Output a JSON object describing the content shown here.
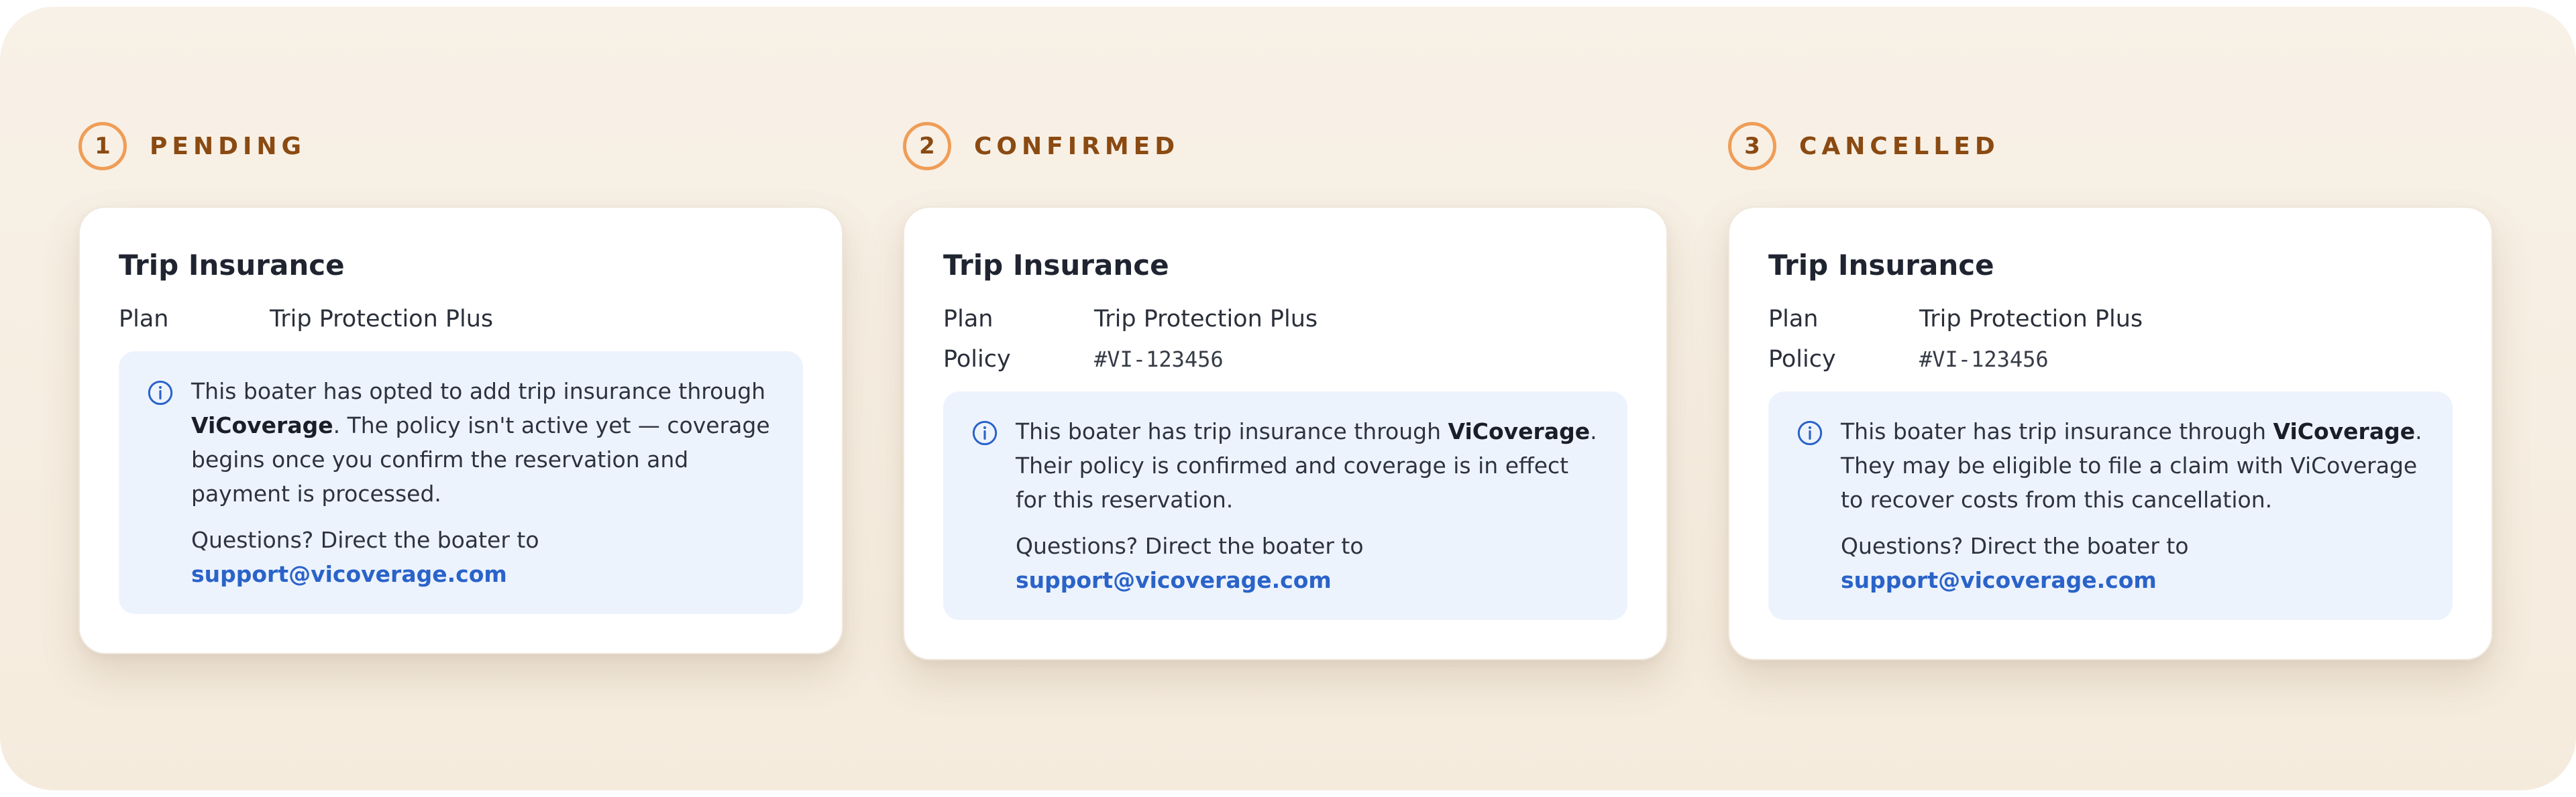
{
  "steps": [
    {
      "number": "1",
      "status": "PENDING",
      "card": {
        "title": "Trip Insurance",
        "plan_label": "Plan",
        "plan_value": "Trip Protection Plus",
        "message_before": "This boater has opted to add trip insurance through ",
        "provider": "ViCoverage",
        "message_after": ". The policy isn't active yet — coverage begins once you confirm the reservation and payment is processed.",
        "questions_text": "Questions? Direct the boater to",
        "support_email": "support@vicoverage.com"
      }
    },
    {
      "number": "2",
      "status": "CONFIRMED",
      "card": {
        "title": "Trip Insurance",
        "plan_label": "Plan",
        "plan_value": "Trip Protection Plus",
        "policy_label": "Policy",
        "policy_value": "#VI-123456",
        "message_before": "This boater has trip insurance through ",
        "provider": "ViCoverage",
        "message_after": ". Their policy is confirmed and coverage is in effect for this reservation.",
        "questions_text": "Questions? Direct the boater to",
        "support_email": "support@vicoverage.com"
      }
    },
    {
      "number": "3",
      "status": "CANCELLED",
      "card": {
        "title": "Trip Insurance",
        "plan_label": "Plan",
        "plan_value": "Trip Protection Plus",
        "policy_label": "Policy",
        "policy_value": "#VI-123456",
        "message_before": "This boater has trip insurance through ",
        "provider": "ViCoverage",
        "message_after": ". They may be eligible to file a claim with ViCoverage to recover costs from this cancellation.",
        "questions_text": "Questions? Direct the boater to",
        "support_email": "support@vicoverage.com"
      }
    }
  ],
  "icons": {
    "info": "info-circle-icon"
  },
  "colors": {
    "background": "#f7eee2",
    "accent_ring": "#ef9d57",
    "status_text": "#8a4a12",
    "info_box": "#edf3fd",
    "link": "#2a63c9"
  }
}
